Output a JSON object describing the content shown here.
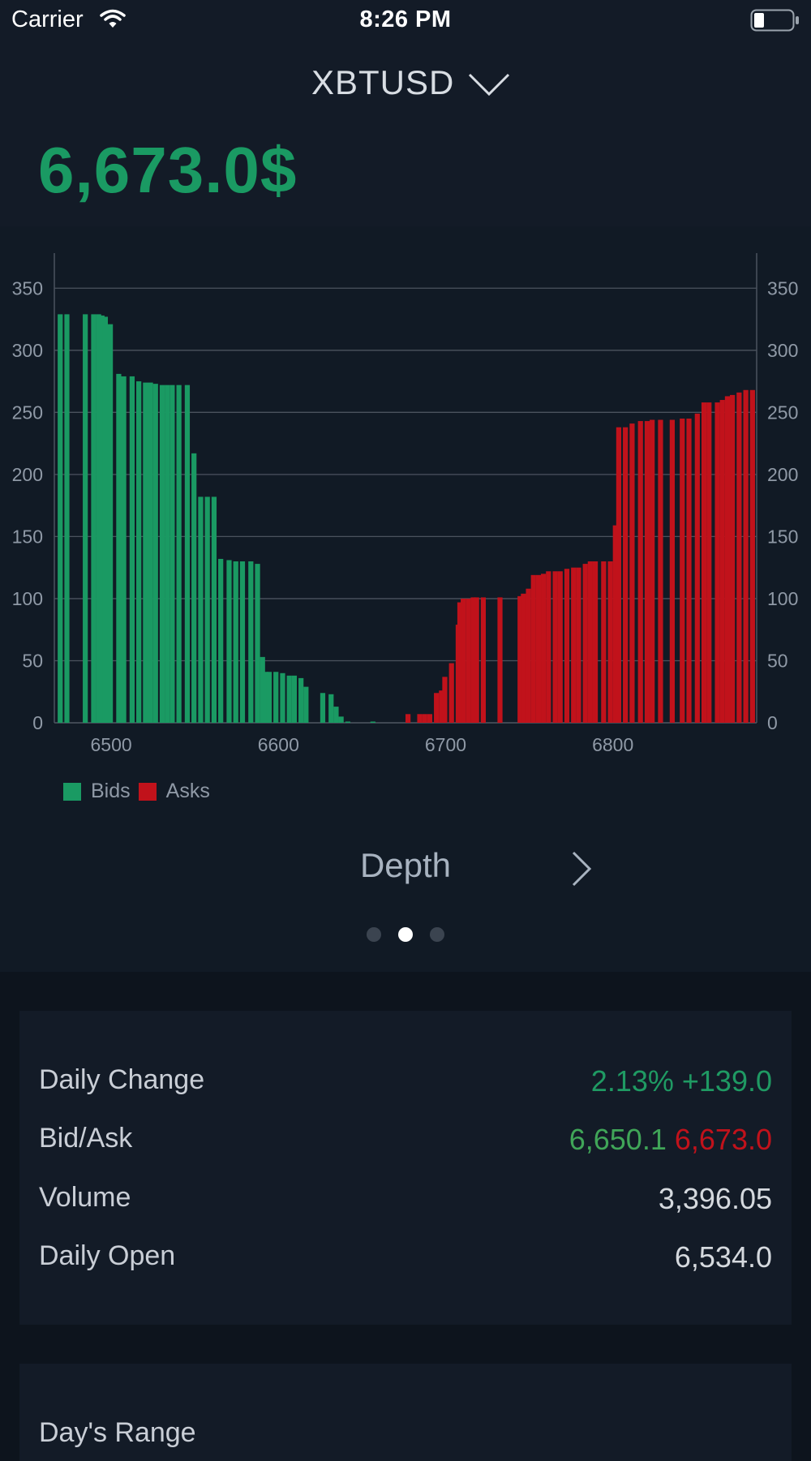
{
  "status_bar": {
    "carrier": "Carrier",
    "time": "8:26 PM",
    "icons": [
      "wifi-icon",
      "battery-icon"
    ]
  },
  "header": {
    "symbol": "XBTUSD",
    "dropdown_icon": "chevron-down-icon",
    "price": "6,673.0$",
    "price_color": "#1a9a63"
  },
  "chart_data": {
    "type": "bar",
    "title": "",
    "xlabel": "",
    "ylabel": "",
    "xlim": [
      6466,
      6886
    ],
    "ylim": [
      0,
      375
    ],
    "x_ticks": [
      6500,
      6600,
      6700,
      6800
    ],
    "y_ticks": [
      0,
      50,
      100,
      150,
      200,
      250,
      300,
      350
    ],
    "y_axis_sides": [
      "left",
      "right"
    ],
    "grid": true,
    "legend_position": "bottom-left",
    "series": [
      {
        "name": "Bids",
        "color": "#1a9a63",
        "points": [
          [
            6468,
            329
          ],
          [
            6472,
            329
          ],
          [
            6483,
            329
          ],
          [
            6488,
            329
          ],
          [
            6491,
            329
          ],
          [
            6493,
            328
          ],
          [
            6495,
            327
          ],
          [
            6498,
            321
          ],
          [
            6503,
            281
          ],
          [
            6506,
            279
          ],
          [
            6511,
            279
          ],
          [
            6515,
            275
          ],
          [
            6519,
            274
          ],
          [
            6522,
            274
          ],
          [
            6525,
            273
          ],
          [
            6529,
            272
          ],
          [
            6532,
            272
          ],
          [
            6535,
            272
          ],
          [
            6539,
            272
          ],
          [
            6544,
            272
          ],
          [
            6548,
            217
          ],
          [
            6552,
            182
          ],
          [
            6556,
            182
          ],
          [
            6560,
            182
          ],
          [
            6564,
            132
          ],
          [
            6569,
            131
          ],
          [
            6573,
            130
          ],
          [
            6577,
            130
          ],
          [
            6582,
            130
          ],
          [
            6586,
            128
          ],
          [
            6589,
            53
          ],
          [
            6591,
            41
          ],
          [
            6593,
            41
          ],
          [
            6597,
            41
          ],
          [
            6601,
            40
          ],
          [
            6605,
            38
          ],
          [
            6608,
            38
          ],
          [
            6612,
            36
          ],
          [
            6615,
            29
          ],
          [
            6625,
            24
          ],
          [
            6630,
            23
          ],
          [
            6633,
            13
          ],
          [
            6636,
            5
          ],
          [
            6640,
            1
          ],
          [
            6655,
            1
          ]
        ]
      },
      {
        "name": "Asks",
        "color": "#c1121b",
        "points": [
          [
            6676,
            7
          ],
          [
            6683,
            7
          ],
          [
            6686,
            7
          ],
          [
            6689,
            7
          ],
          [
            6693,
            24
          ],
          [
            6696,
            26
          ],
          [
            6698,
            37
          ],
          [
            6702,
            48
          ],
          [
            6706,
            79
          ],
          [
            6707,
            97
          ],
          [
            6709,
            100
          ],
          [
            6712,
            100
          ],
          [
            6715,
            101
          ],
          [
            6717,
            101
          ],
          [
            6721,
            101
          ],
          [
            6731,
            101
          ],
          [
            6743,
            102
          ],
          [
            6745,
            104
          ],
          [
            6748,
            108
          ],
          [
            6751,
            119
          ],
          [
            6754,
            119
          ],
          [
            6757,
            120
          ],
          [
            6760,
            122
          ],
          [
            6764,
            122
          ],
          [
            6767,
            122
          ],
          [
            6771,
            124
          ],
          [
            6775,
            125
          ],
          [
            6778,
            125
          ],
          [
            6782,
            128
          ],
          [
            6785,
            130
          ],
          [
            6788,
            130
          ],
          [
            6793,
            130
          ],
          [
            6797,
            130
          ],
          [
            6800,
            159
          ],
          [
            6802,
            238
          ],
          [
            6806,
            238
          ],
          [
            6810,
            241
          ],
          [
            6815,
            243
          ],
          [
            6819,
            243
          ],
          [
            6822,
            244
          ],
          [
            6827,
            244
          ],
          [
            6834,
            244
          ],
          [
            6840,
            245
          ],
          [
            6844,
            245
          ],
          [
            6849,
            249
          ],
          [
            6853,
            258
          ],
          [
            6856,
            258
          ],
          [
            6861,
            258
          ],
          [
            6864,
            260
          ],
          [
            6867,
            263
          ],
          [
            6870,
            264
          ],
          [
            6874,
            266
          ],
          [
            6878,
            268
          ],
          [
            6882,
            268
          ]
        ]
      }
    ]
  },
  "pager": {
    "title": "Depth",
    "next_icon": "chevron-right-icon",
    "page_count": 3,
    "current_page": 2
  },
  "stats": {
    "daily_change": {
      "label": "Daily Change",
      "value": "2.13% +139.0"
    },
    "bid_ask": {
      "label": "Bid/Ask",
      "bid": "6,650.1",
      "ask": "6,673.0"
    },
    "volume": {
      "label": "Volume",
      "value": "3,396.05"
    },
    "daily_open": {
      "label": "Daily Open",
      "value": "6,534.0"
    }
  },
  "range_card": {
    "title": "Day's Range"
  },
  "colors": {
    "background": "#0d141d",
    "panel": "#131b27",
    "chart_panel": "#111a25",
    "bids": "#1a9a63",
    "asks": "#c1121b",
    "grid": "#4b535e",
    "axis_text": "#8f99a6"
  }
}
